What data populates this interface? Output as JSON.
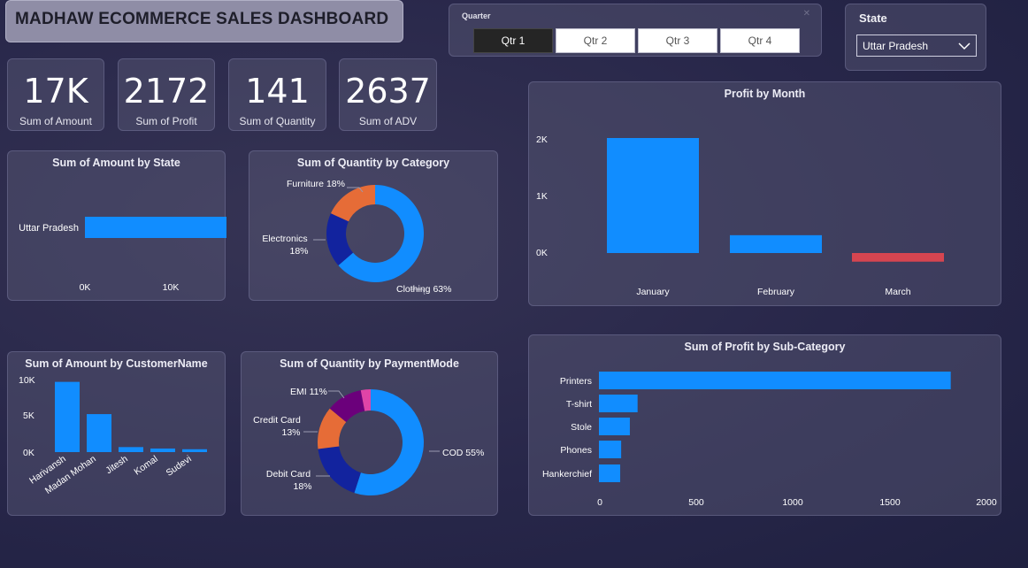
{
  "header": {
    "title": "MADHAW ECOMMERCE SALES DASHBOARD"
  },
  "quarter_slicer": {
    "label": "Quarter",
    "options": [
      "Qtr 1",
      "Qtr 2",
      "Qtr 3",
      "Qtr 4"
    ],
    "selected": "Qtr 1"
  },
  "state_slicer": {
    "label": "State",
    "selected": "Uttar Pradesh"
  },
  "kpis": [
    {
      "value": "17K",
      "label": "Sum of Amount"
    },
    {
      "value": "2172",
      "label": "Sum of Profit"
    },
    {
      "value": "141",
      "label": "Sum of Quantity"
    },
    {
      "value": "2637",
      "label": "Sum of ADV"
    }
  ],
  "colors": {
    "primary": "#118dff",
    "negative": "#d64550",
    "dark_blue": "#12239e",
    "orange": "#e66c37",
    "purple": "#6b007b",
    "pink": "#e044a7"
  },
  "chart_data": [
    {
      "id": "amount_by_state",
      "type": "bar",
      "orientation": "horizontal",
      "title": "Sum of Amount by State",
      "categories": [
        "Uttar Pradesh"
      ],
      "values": [
        17000
      ],
      "ticks": [
        "0K",
        "10K"
      ],
      "xlim": [
        0,
        17500
      ]
    },
    {
      "id": "quantity_by_category",
      "type": "pie",
      "donut": true,
      "title": "Sum of Quantity by Category",
      "labels": [
        "Clothing",
        "Electronics",
        "Furniture"
      ],
      "values": [
        63,
        18,
        18
      ],
      "value_labels": [
        "63%",
        "18%",
        "18%"
      ],
      "colors": [
        "#118dff",
        "#12239e",
        "#e66c37"
      ]
    },
    {
      "id": "profit_by_month",
      "type": "bar",
      "title": "Profit by Month",
      "categories": [
        "January",
        "February",
        "March"
      ],
      "values": [
        2000,
        310,
        -150
      ],
      "ticks": [
        "0K",
        "1K",
        "2K"
      ],
      "ylim": [
        -200,
        2100
      ]
    },
    {
      "id": "amount_by_customer",
      "type": "bar",
      "title": "Sum of Amount by CustomerName",
      "categories": [
        "Harivansh",
        "Madan Mohan",
        "Jitesh",
        "Komal",
        "Sudevi"
      ],
      "values": [
        9800,
        5300,
        700,
        500,
        400
      ],
      "ticks": [
        "0K",
        "5K",
        "10K"
      ],
      "ylim": [
        0,
        10000
      ]
    },
    {
      "id": "quantity_by_paymentmode",
      "type": "pie",
      "donut": true,
      "title": "Sum of Quantity by PaymentMode",
      "labels": [
        "COD",
        "Debit Card",
        "Credit Card",
        "EMI",
        ""
      ],
      "values": [
        55,
        18,
        13,
        11,
        3
      ],
      "value_labels": [
        "55%",
        "18%",
        "13%",
        "11%",
        ""
      ],
      "colors": [
        "#118dff",
        "#12239e",
        "#e66c37",
        "#6b007b",
        "#e044a7"
      ]
    },
    {
      "id": "profit_by_subcategory",
      "type": "bar",
      "orientation": "horizontal",
      "title": "Sum of Profit by Sub-Category",
      "categories": [
        "Printers",
        "T-shirt",
        "Stole",
        "Phones",
        "Hankerchief"
      ],
      "values": [
        1820,
        200,
        160,
        115,
        110
      ],
      "ticks": [
        "0",
        "500",
        "1000",
        "1500",
        "2000"
      ],
      "xlim": [
        0,
        2000
      ]
    }
  ]
}
